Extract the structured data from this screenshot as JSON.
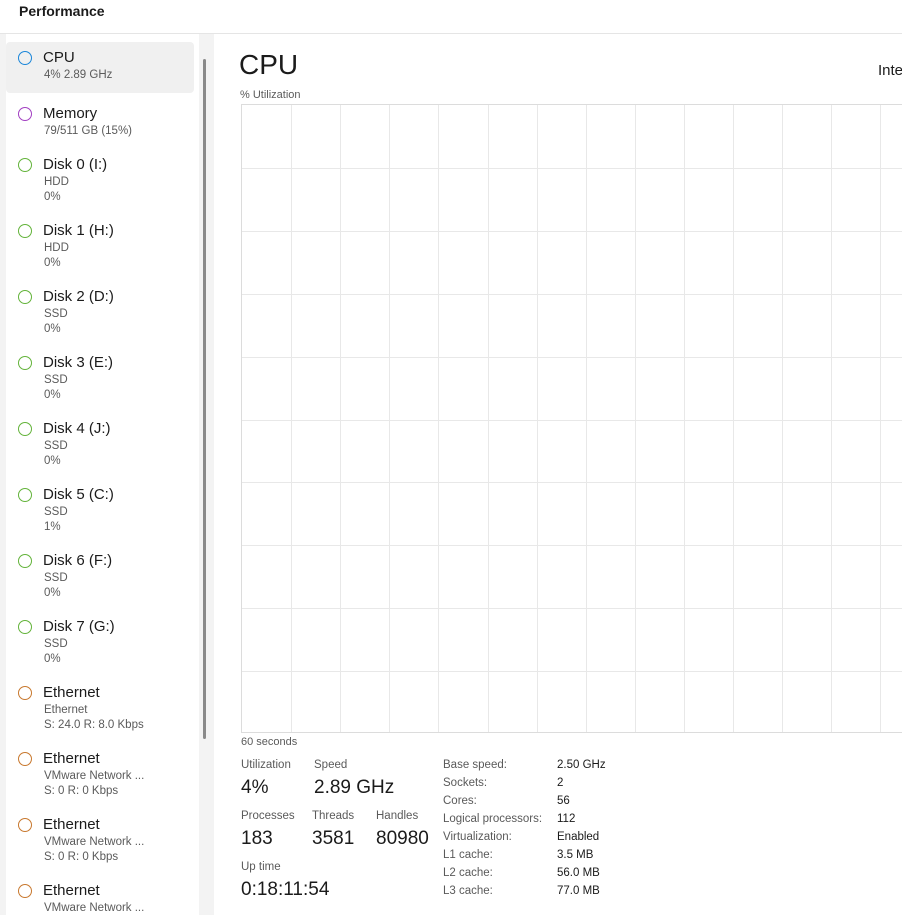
{
  "header": {
    "title": "Performance"
  },
  "sidebar": {
    "items": [
      {
        "name": "CPU",
        "line1": "4%  2.89 GHz",
        "line2": "",
        "dot_color": "#1a86d9",
        "selected": true
      },
      {
        "name": "Memory",
        "line1": "79/511 GB (15%)",
        "line2": "",
        "dot_color": "#a23fc2",
        "selected": false
      },
      {
        "name": "Disk 0 (I:)",
        "line1": "HDD",
        "line2": "0%",
        "dot_color": "#63b33a",
        "selected": false
      },
      {
        "name": "Disk 1 (H:)",
        "line1": "HDD",
        "line2": "0%",
        "dot_color": "#63b33a",
        "selected": false
      },
      {
        "name": "Disk 2 (D:)",
        "line1": "SSD",
        "line2": "0%",
        "dot_color": "#63b33a",
        "selected": false
      },
      {
        "name": "Disk 3 (E:)",
        "line1": "SSD",
        "line2": "0%",
        "dot_color": "#63b33a",
        "selected": false
      },
      {
        "name": "Disk 4 (J:)",
        "line1": "SSD",
        "line2": "0%",
        "dot_color": "#63b33a",
        "selected": false
      },
      {
        "name": "Disk 5 (C:)",
        "line1": "SSD",
        "line2": "1%",
        "dot_color": "#63b33a",
        "selected": false
      },
      {
        "name": "Disk 6 (F:)",
        "line1": "SSD",
        "line2": "0%",
        "dot_color": "#63b33a",
        "selected": false
      },
      {
        "name": "Disk 7 (G:)",
        "line1": "SSD",
        "line2": "0%",
        "dot_color": "#63b33a",
        "selected": false
      },
      {
        "name": "Ethernet",
        "line1": "Ethernet",
        "line2": "S: 24.0  R: 8.0 Kbps",
        "dot_color": "#c8782e",
        "selected": false
      },
      {
        "name": "Ethernet",
        "line1": "VMware Network ...",
        "line2": "S: 0  R: 0 Kbps",
        "dot_color": "#c8782e",
        "selected": false
      },
      {
        "name": "Ethernet",
        "line1": "VMware Network ...",
        "line2": "S: 0  R: 0 Kbps",
        "dot_color": "#c8782e",
        "selected": false
      },
      {
        "name": "Ethernet",
        "line1": "VMware Network ...",
        "line2": "",
        "dot_color": "#c8782e",
        "selected": false
      }
    ]
  },
  "main": {
    "title": "CPU",
    "model": "Inte",
    "util_label": "% Utilization",
    "time_label": "60 seconds",
    "stats": {
      "utilization_label": "Utilization",
      "utilization_value": "4%",
      "speed_label": "Speed",
      "speed_value": "2.89 GHz",
      "processes_label": "Processes",
      "processes_value": "183",
      "threads_label": "Threads",
      "threads_value": "3581",
      "handles_label": "Handles",
      "handles_value": "80980",
      "uptime_label": "Up time",
      "uptime_value": "0:18:11:54"
    },
    "specs": [
      {
        "label": "Base speed:",
        "value": "2.50 GHz"
      },
      {
        "label": "Sockets:",
        "value": "2"
      },
      {
        "label": "Cores:",
        "value": "56"
      },
      {
        "label": "Logical processors:",
        "value": "112"
      },
      {
        "label": "Virtualization:",
        "value": "Enabled"
      },
      {
        "label": "L1 cache:",
        "value": "3.5 MB"
      },
      {
        "label": "L2 cache:",
        "value": "56.0 MB"
      },
      {
        "label": "L3 cache:",
        "value": "77.0 MB"
      }
    ],
    "grid_color": "#e8e8e8"
  }
}
